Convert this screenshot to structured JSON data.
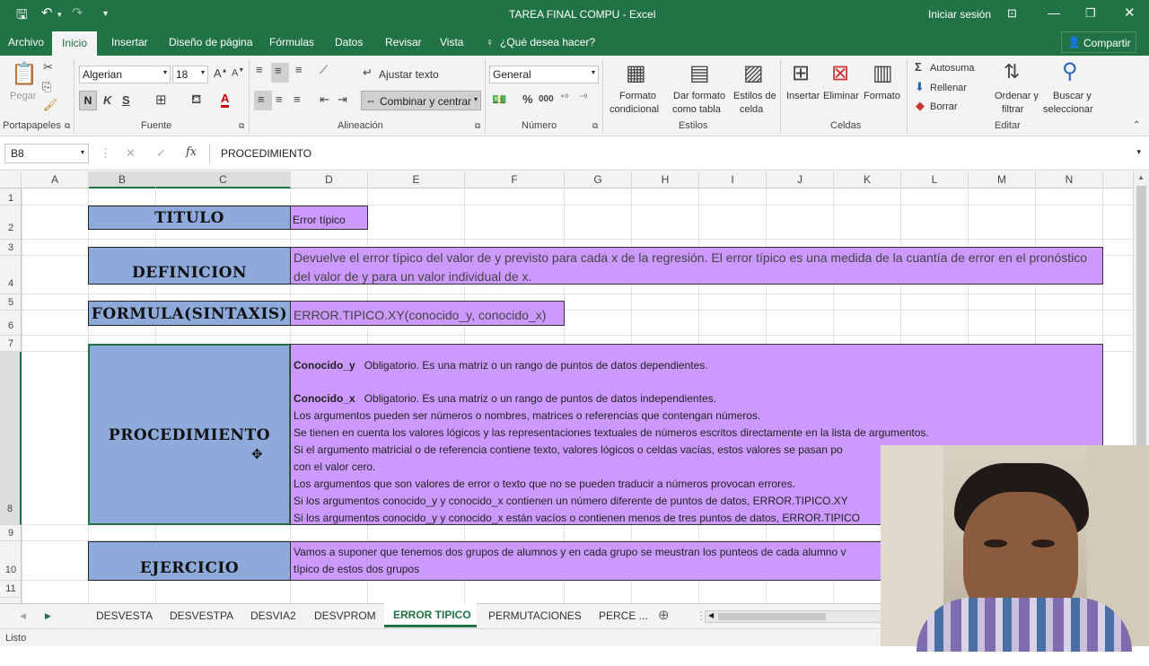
{
  "window": {
    "title": "TAREA FINAL COMPU - Excel",
    "signin": "Iniciar sesión"
  },
  "ribbon_tabs": [
    "Archivo",
    "Inicio",
    "Insertar",
    "Diseño de página",
    "Fórmulas",
    "Datos",
    "Revisar",
    "Vista"
  ],
  "tell_me": "¿Qué desea hacer?",
  "share": "Compartir",
  "ribbon": {
    "paste": "Pegar",
    "font_name": "Algerian",
    "font_size": "18",
    "bold": "N",
    "italic": "K",
    "underline": "S",
    "wrap_text": "Ajustar texto",
    "merge_center": "Combinar y centrar",
    "number_format": "General",
    "percent": "%",
    "thousands": "000",
    "cond_format_1": "Formato",
    "cond_format_2": "condicional",
    "format_table_1": "Dar formato",
    "format_table_2": "como tabla",
    "cell_styles_1": "Estilos de",
    "cell_styles_2": "celda",
    "insert": "Insertar",
    "delete": "Eliminar",
    "format": "Formato",
    "autosum": "Autosuma",
    "fill": "Rellenar",
    "clear": "Borrar",
    "sort_1": "Ordenar y",
    "sort_2": "filtrar",
    "find_1": "Buscar y",
    "find_2": "seleccionar",
    "groups": {
      "clipboard": "Portapapeles",
      "font": "Fuente",
      "alignment": "Alineación",
      "number": "Número",
      "styles": "Estilos",
      "cells": "Celdas",
      "editing": "Editar"
    }
  },
  "formula_bar": {
    "name_box": "B8",
    "formula": "PROCEDIMIENTO"
  },
  "columns": [
    "A",
    "B",
    "C",
    "D",
    "E",
    "F",
    "G",
    "H",
    "I",
    "J",
    "K",
    "L",
    "M",
    "N"
  ],
  "rows": [
    "1",
    "2",
    "3",
    "4",
    "5",
    "6",
    "7",
    "8",
    "9",
    "10",
    "11"
  ],
  "cells": {
    "titulo_label": "TITULO",
    "titulo_value": "Error típico",
    "definicion_label": "DEFINICION",
    "definicion_value": "Devuelve el error típico del valor de y previsto para cada x de la regresión. El error típico es una medida de la cuantía de error en el pronóstico del valor de y para un valor individual de x.",
    "formula_label": "FORMULA(SINTAXIS)",
    "formula_value": "ERROR.TIPICO.XY(conocido_y, conocido_x)",
    "procedimiento_label": "PROCEDIMIENTO",
    "proc_line1_term": "Conocido_y",
    "proc_line1_text": "Obligatorio. Es una matriz o un rango de puntos de datos dependientes.",
    "proc_line2_term": "Conocido_x",
    "proc_line2_text": "Obligatorio. Es una matriz o un rango de puntos de datos independientes.",
    "proc_line3": "Los argumentos pueden ser números o nombres, matrices o referencias que contengan números.",
    "proc_line4": "Se tienen en cuenta los valores lógicos y las representaciones textuales de números escritos directamente en la lista de argumentos.",
    "proc_line5": "Si el argumento matricial o de referencia contiene texto, valores lógicos o celdas vacías, estos valores se pasan po",
    "proc_line6": "con el valor cero.",
    "proc_line7": "Los argumentos que son valores de error o texto que no se pueden traducir a números provocan errores.",
    "proc_line8": "Si los argumentos conocido_y y conocido_x contienen un número diferente de puntos de datos, ERROR.TIPICO.XY",
    "proc_line9": "Si los argumentos conocido_y y conocido_x están vacíos o contienen menos de tres puntos de datos, ERROR.TIPICO",
    "ejercicio_label": "EJERCICIO",
    "ejercicio_line1": "Vamos a suponer que tenemos dos grupos de alumnos y en cada grupo se meustran los punteos de cada alumno v",
    "ejercicio_line2": "típico de estos dos grupos"
  },
  "sheet_tabs": [
    "DESVESTA",
    "DESVESTPA",
    "DESVIA2",
    "DESVPROM",
    "ERROR TIPICO",
    "PERMUTACIONES",
    "PERCE ..."
  ],
  "active_sheet": "ERROR TIPICO",
  "status": "Listo",
  "colors": {
    "excel_green": "#217346",
    "label_blue": "#8eaadb",
    "value_purple": "#cc99ff"
  }
}
